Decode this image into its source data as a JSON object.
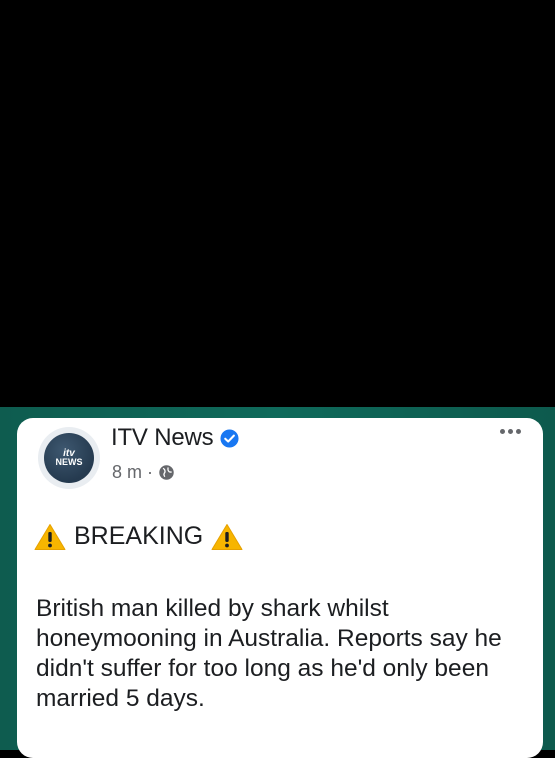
{
  "post": {
    "page_name": "ITV News",
    "timestamp": "8 m",
    "separator": "·",
    "avatar": {
      "line1": "itv",
      "line2": "NEWS"
    },
    "breaking_label": "BREAKING",
    "body": "British man killed by shark whilst honeymooning in Australia. Reports say he didn't suffer for too long as he'd only been married 5 days."
  },
  "icons": {
    "verified": "verified-badge-icon",
    "audience": "globe-icon",
    "more": "more-options-icon",
    "warning": "warning-icon"
  },
  "colors": {
    "frame": "#0f6a5b",
    "verified": "#1877f2",
    "warning": "#f7b500",
    "text": "#1c1e21",
    "meta": "#65676b"
  }
}
